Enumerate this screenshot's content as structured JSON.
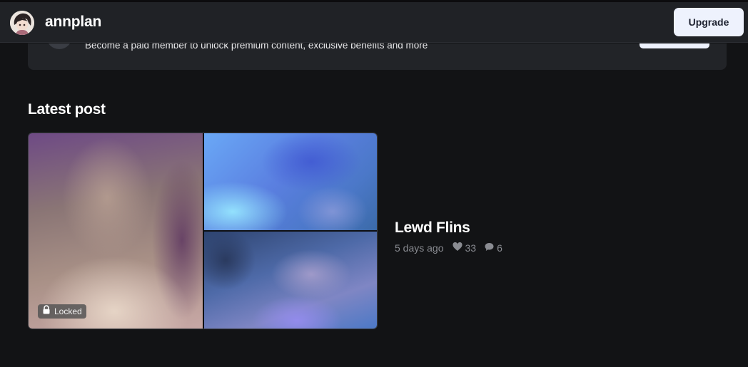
{
  "header": {
    "creator_name": "annplan",
    "upgrade_label": "Upgrade"
  },
  "banner": {
    "text": "Become a paid member to unlock premium content, exclusive benefits and more"
  },
  "latest": {
    "section_title": "Latest post",
    "locked_label": "Locked",
    "post_title": "Lewd Flins",
    "posted_ago": "5 days ago",
    "likes": "33",
    "comments": "6"
  },
  "icons": {
    "lock": "lock-icon",
    "heart": "heart-icon",
    "comment": "comment-icon"
  },
  "colors": {
    "background": "#121315",
    "header": "#202226",
    "button": "#eef2fd",
    "muted_text": "#8a8c92"
  }
}
